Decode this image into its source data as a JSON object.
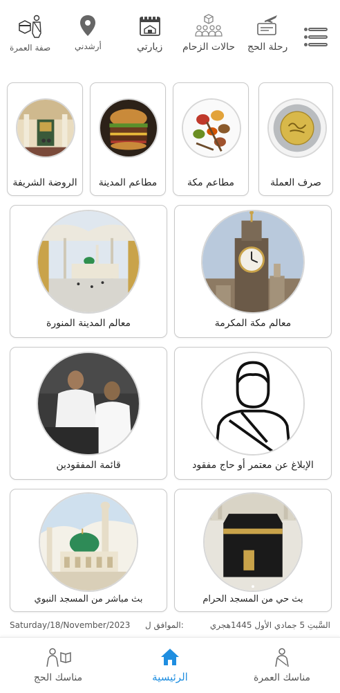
{
  "topnav": {
    "items": [
      {
        "label": "رحلة الحج",
        "icon": "plane-ticket-icon"
      },
      {
        "label": "حالات الزحام",
        "icon": "crowd-icon"
      },
      {
        "label": "زيارتي",
        "icon": "calendar-icon"
      },
      {
        "label": "أرشدني",
        "icon": "location-pin-icon"
      },
      {
        "label": "صفة العمرة",
        "icon": "pilgrim-icon"
      }
    ],
    "menu_icon": "menu-icon"
  },
  "small_cards": [
    {
      "label": "صرف العملة",
      "image": "coin-image"
    },
    {
      "label": "مطاعم مكة",
      "image": "spices-image"
    },
    {
      "label": "مطاعم المدينة",
      "image": "burger-image"
    },
    {
      "label": "الروضة الشريفة",
      "image": "rawdah-image"
    }
  ],
  "large_cards": [
    {
      "label": "معالم مكة المكرمة",
      "image": "clock-tower-image"
    },
    {
      "label": "معالم المدينة المنورة",
      "image": "prophet-mosque-umbrellas-image"
    },
    {
      "label": "الإبلاغ عن معتمر أو حاج مفقود",
      "image": "pilgrim-outline-image"
    },
    {
      "label": "قائمة المفقودين",
      "image": "pilgrims-sitting-image"
    },
    {
      "label": "بث حي من المسجد الحرام",
      "image": "kaaba-image"
    },
    {
      "label": "بث مباشر من المسجد النبوي",
      "image": "green-dome-image"
    }
  ],
  "dateline": {
    "hijri": "السَّبتِ 5 جمادي الأول 1445هجري",
    "muwafiq": "الموافق ل:",
    "gregorian": "Saturday/18/November/2023"
  },
  "bottom_nav": {
    "items": [
      {
        "label": "مناسك العمرة",
        "icon": "pilgrim-icon"
      },
      {
        "label": "الرئيسية",
        "icon": "home-icon",
        "active": true
      },
      {
        "label": "مناسك الحج",
        "icon": "pilgrim-book-icon"
      }
    ]
  },
  "colors": {
    "accent": "#1f8ee0",
    "border": "#c8c8c8",
    "icon_gray": "#666666"
  }
}
